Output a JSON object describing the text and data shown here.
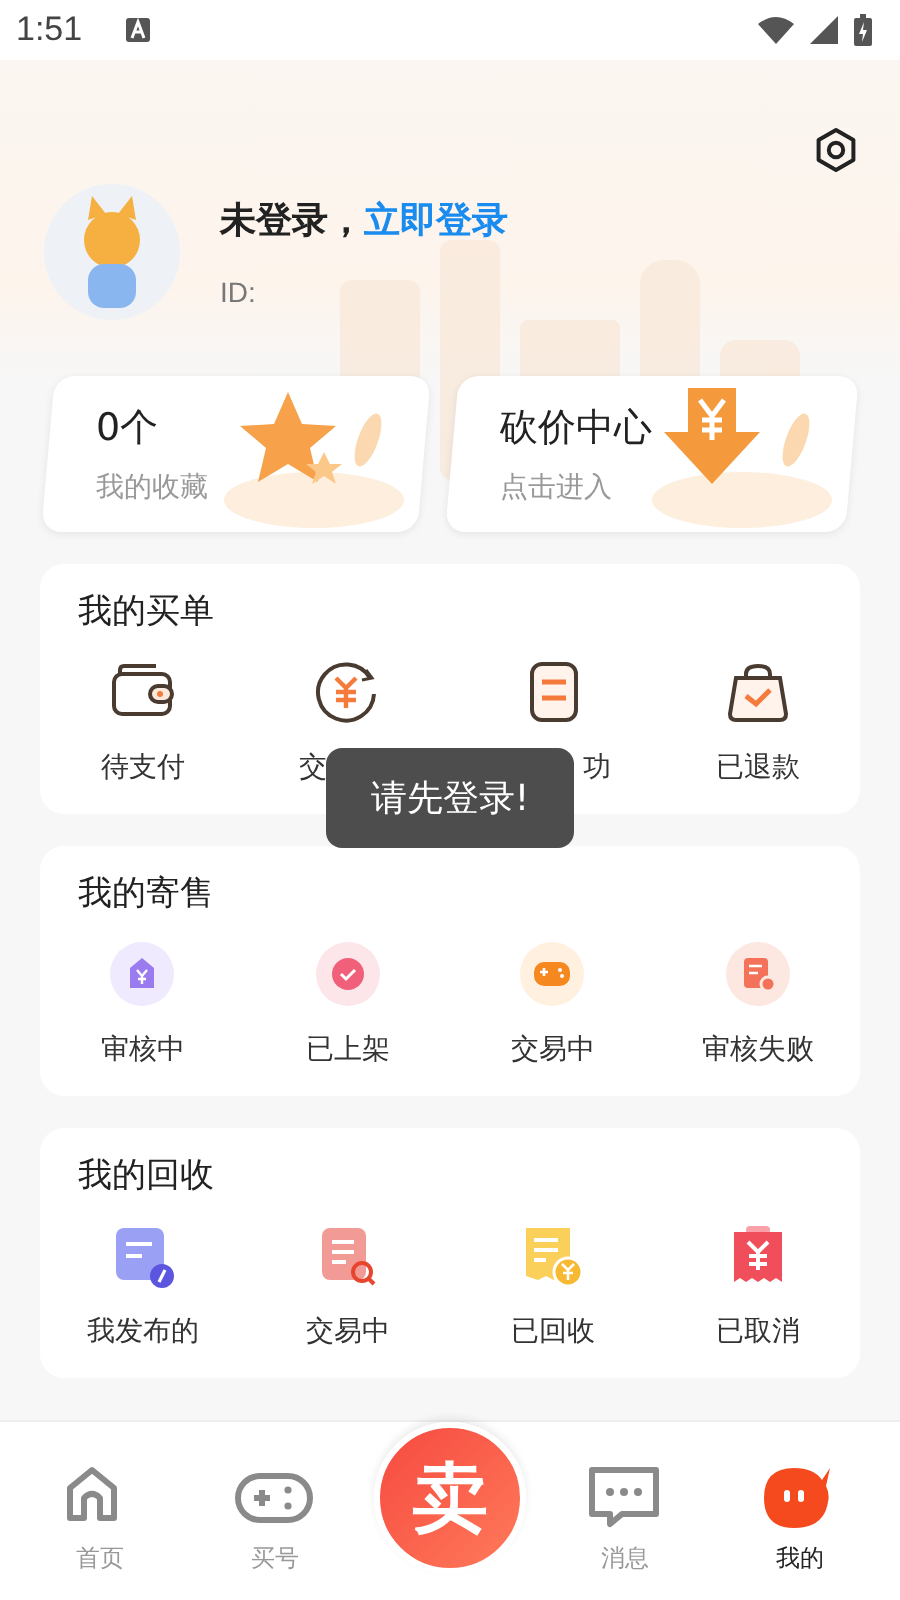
{
  "status_bar": {
    "time": "1:51"
  },
  "profile": {
    "name_prefix": "未登录，",
    "login_link": "立即登录",
    "id_label": "ID:"
  },
  "quick_cards": [
    {
      "kind": "favorites",
      "value": "0个",
      "label": "我的收藏"
    },
    {
      "kind": "bargain",
      "value": "砍价中心",
      "label": "点击进入"
    }
  ],
  "sections": [
    {
      "title": "我的买单",
      "items": [
        {
          "label": "待支付"
        },
        {
          "label": "交"
        },
        {
          "label": "功"
        },
        {
          "label": "已退款"
        }
      ]
    },
    {
      "title": "我的寄售",
      "items": [
        {
          "label": "审核中"
        },
        {
          "label": "已上架"
        },
        {
          "label": "交易中"
        },
        {
          "label": "审核失败"
        }
      ]
    },
    {
      "title": "我的回收",
      "items": [
        {
          "label": "我发布的"
        },
        {
          "label": "交易中"
        },
        {
          "label": "已回收"
        },
        {
          "label": "已取消"
        }
      ]
    }
  ],
  "toast": "请先登录!",
  "tab_bar": [
    {
      "kind": "tab",
      "label": "首页",
      "selected": false
    },
    {
      "kind": "tab",
      "label": "买号",
      "selected": false
    },
    {
      "kind": "sell",
      "label": "卖"
    },
    {
      "kind": "tab",
      "label": "消息",
      "selected": false
    },
    {
      "kind": "tab",
      "label": "我的",
      "selected": true
    }
  ]
}
